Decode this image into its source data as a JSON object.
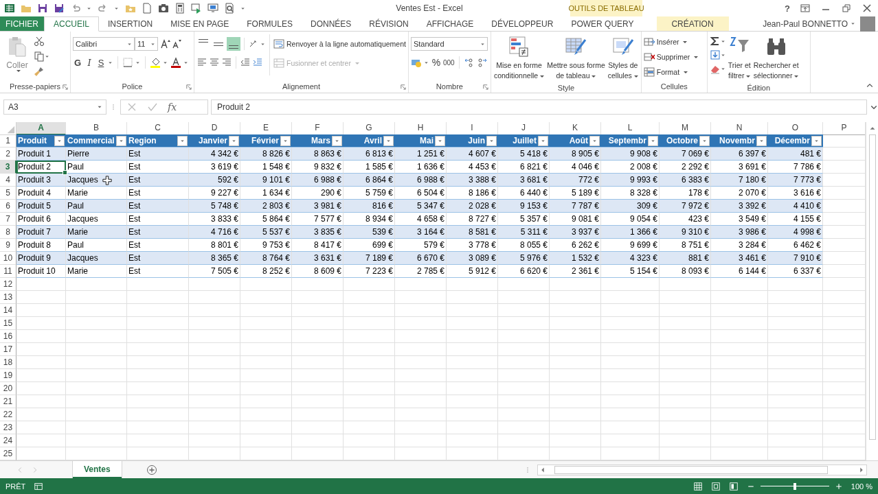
{
  "window": {
    "title": "Ventes Est - Excel",
    "context_group": "OUTILS DE TABLEAU",
    "help": "?"
  },
  "ribbon_tabs": [
    {
      "label": "FICHIER",
      "kind": "file",
      "selected": false
    },
    {
      "label": "ACCUEIL",
      "kind": "normal",
      "selected": true
    },
    {
      "label": "INSERTION",
      "kind": "normal",
      "selected": false
    },
    {
      "label": "MISE EN PAGE",
      "kind": "normal",
      "selected": false
    },
    {
      "label": "FORMULES",
      "kind": "normal",
      "selected": false
    },
    {
      "label": "DONNÉES",
      "kind": "normal",
      "selected": false
    },
    {
      "label": "RÉVISION",
      "kind": "normal",
      "selected": false
    },
    {
      "label": "AFFICHAGE",
      "kind": "normal",
      "selected": false
    },
    {
      "label": "DÉVELOPPEUR",
      "kind": "normal",
      "selected": false
    },
    {
      "label": "POWER QUERY",
      "kind": "normal",
      "selected": false
    },
    {
      "label": "CRÉATION",
      "kind": "context",
      "selected": false
    }
  ],
  "user": {
    "name": "Jean-Paul BONNETTO"
  },
  "ribbon": [
    {
      "kind": "clipboard",
      "label": "Presse-papiers",
      "paste": "Coller"
    },
    {
      "kind": "font",
      "label": "Police",
      "font": "Calibri",
      "size": "11",
      "bold": "G",
      "italic": "I",
      "underline": "S"
    },
    {
      "kind": "alignment",
      "label": "Alignement",
      "vertical_align": [
        {
          "selected": false
        },
        {
          "selected": false
        },
        {
          "selected": true
        }
      ],
      "wrap": "Renvoyer à la ligne automatiquement",
      "merge": {
        "label": "Fusionner et centrer",
        "disabled": true
      }
    },
    {
      "kind": "number",
      "label": "Nombre",
      "format": "Standard",
      "percent": "%",
      "thousands": "000"
    },
    {
      "kind": "styles",
      "label": "Style",
      "buttons": [
        {
          "lines": [
            "Mise en forme",
            "conditionnelle"
          ]
        },
        {
          "lines": [
            "Mettre sous forme",
            "de tableau"
          ]
        },
        {
          "lines": [
            "Styles de",
            "cellules"
          ]
        }
      ]
    },
    {
      "kind": "cells",
      "label": "Cellules",
      "items": [
        "Insérer",
        "Supprimer",
        "Format"
      ]
    },
    {
      "kind": "editing",
      "label": "Édition",
      "buttons": [
        {
          "lines": [
            "Trier et",
            "filtrer"
          ]
        },
        {
          "lines": [
            "Rechercher et",
            "sélectionner"
          ]
        }
      ]
    }
  ],
  "formula_bar": {
    "name_box": "A3",
    "function_label": "fx",
    "formula": "Produit 2"
  },
  "sheet": {
    "columns": [
      {
        "letter": "A",
        "selected": true
      },
      {
        "letter": "B",
        "selected": false
      },
      {
        "letter": "C",
        "selected": false
      },
      {
        "letter": "D",
        "selected": false
      },
      {
        "letter": "E",
        "selected": false
      },
      {
        "letter": "F",
        "selected": false
      },
      {
        "letter": "G",
        "selected": false
      },
      {
        "letter": "H",
        "selected": false
      },
      {
        "letter": "I",
        "selected": false
      },
      {
        "letter": "J",
        "selected": false
      },
      {
        "letter": "K",
        "selected": false
      },
      {
        "letter": "L",
        "selected": false
      },
      {
        "letter": "M",
        "selected": false
      },
      {
        "letter": "N",
        "selected": false
      },
      {
        "letter": "O",
        "selected": false
      },
      {
        "letter": "P",
        "selected": false
      }
    ],
    "header_row": {
      "number": "1",
      "selected": false
    },
    "headers": [
      {
        "label": "Produit",
        "kind": "text"
      },
      {
        "label": "Commercial",
        "kind": "text"
      },
      {
        "label": "Region",
        "kind": "text"
      },
      {
        "label": "Janvier",
        "kind": "number"
      },
      {
        "label": "Février",
        "kind": "number"
      },
      {
        "label": "Mars",
        "kind": "number"
      },
      {
        "label": "Avril",
        "kind": "number"
      },
      {
        "label": "Mai",
        "kind": "number"
      },
      {
        "label": "Juin",
        "kind": "number"
      },
      {
        "label": "Juillet",
        "kind": "number"
      },
      {
        "label": "Août",
        "kind": "number"
      },
      {
        "label": "Septembr",
        "kind": "number"
      },
      {
        "label": "Octobre",
        "kind": "number"
      },
      {
        "label": "Novembr",
        "kind": "number"
      },
      {
        "label": "Décembr",
        "kind": "number"
      }
    ],
    "rows": [
      {
        "number": "2",
        "selected": false,
        "cells": [
          "Produit 1",
          "Pierre",
          "Est",
          "4 342 €",
          "8 826 €",
          "8 863 €",
          "6 813 €",
          "1 251 €",
          "4 607 €",
          "5 418 €",
          "8 905 €",
          "9 908 €",
          "7 069 €",
          "6 397 €",
          "481 €"
        ]
      },
      {
        "number": "3",
        "selected": true,
        "cells": [
          "Produit 2",
          "Paul",
          "Est",
          "3 619 €",
          "1 548 €",
          "9 832 €",
          "1 585 €",
          "1 636 €",
          "4 453 €",
          "6 821 €",
          "4 046 €",
          "2 008 €",
          "2 292 €",
          "3 691 €",
          "7 786 €"
        ]
      },
      {
        "number": "4",
        "selected": false,
        "cells": [
          "Produit 3",
          "Jacques",
          "Est",
          "592 €",
          "9 101 €",
          "6 988 €",
          "6 864 €",
          "6 988 €",
          "3 388 €",
          "3 681 €",
          "772 €",
          "9 993 €",
          "6 383 €",
          "7 180 €",
          "7 773 €"
        ]
      },
      {
        "number": "5",
        "selected": false,
        "cells": [
          "Produit 4",
          "Marie",
          "Est",
          "9 227 €",
          "1 634 €",
          "290 €",
          "5 759 €",
          "6 504 €",
          "8 186 €",
          "6 440 €",
          "5 189 €",
          "8 328 €",
          "178 €",
          "2 070 €",
          "3 616 €"
        ]
      },
      {
        "number": "6",
        "selected": false,
        "cells": [
          "Produit 5",
          "Paul",
          "Est",
          "5 748 €",
          "2 803 €",
          "3 981 €",
          "816 €",
          "5 347 €",
          "2 028 €",
          "9 153 €",
          "7 787 €",
          "309 €",
          "7 972 €",
          "3 392 €",
          "4 410 €"
        ]
      },
      {
        "number": "7",
        "selected": false,
        "cells": [
          "Produit 6",
          "Jacques",
          "Est",
          "3 833 €",
          "5 864 €",
          "7 577 €",
          "8 934 €",
          "4 658 €",
          "8 727 €",
          "5 357 €",
          "9 081 €",
          "9 054 €",
          "423 €",
          "3 549 €",
          "4 155 €"
        ]
      },
      {
        "number": "8",
        "selected": false,
        "cells": [
          "Produit 7",
          "Marie",
          "Est",
          "4 716 €",
          "5 537 €",
          "3 835 €",
          "539 €",
          "3 164 €",
          "8 581 €",
          "5 311 €",
          "3 937 €",
          "1 366 €",
          "9 310 €",
          "3 986 €",
          "4 998 €"
        ]
      },
      {
        "number": "9",
        "selected": false,
        "cells": [
          "Produit 8",
          "Paul",
          "Est",
          "8 801 €",
          "9 753 €",
          "8 417 €",
          "699 €",
          "579 €",
          "3 778 €",
          "8 055 €",
          "6 262 €",
          "9 699 €",
          "8 751 €",
          "3 284 €",
          "6 462 €"
        ]
      },
      {
        "number": "10",
        "selected": false,
        "cells": [
          "Produit 9",
          "Jacques",
          "Est",
          "8 365 €",
          "8 764 €",
          "3 631 €",
          "7 189 €",
          "6 670 €",
          "3 089 €",
          "5 976 €",
          "1 532 €",
          "4 323 €",
          "881 €",
          "3 461 €",
          "7 910 €"
        ]
      },
      {
        "number": "11",
        "selected": false,
        "cells": [
          "Produit 10",
          "Marie",
          "Est",
          "7 505 €",
          "8 252 €",
          "8 609 €",
          "7 223 €",
          "2 785 €",
          "5 912 €",
          "6 620 €",
          "2 361 €",
          "5 154 €",
          "8 093 €",
          "6 144 €",
          "6 337 €"
        ]
      }
    ],
    "empty_rows": [
      "12",
      "13",
      "14",
      "15",
      "16",
      "17",
      "18",
      "19",
      "20",
      "21",
      "22",
      "23",
      "24",
      "25"
    ]
  },
  "sheet_tabs": [
    {
      "label": "Ventes",
      "selected": true
    }
  ],
  "status_bar": {
    "status": "PRÊT",
    "zoom": "100 %",
    "zoom_slider": {
      "level": 0.5
    }
  }
}
